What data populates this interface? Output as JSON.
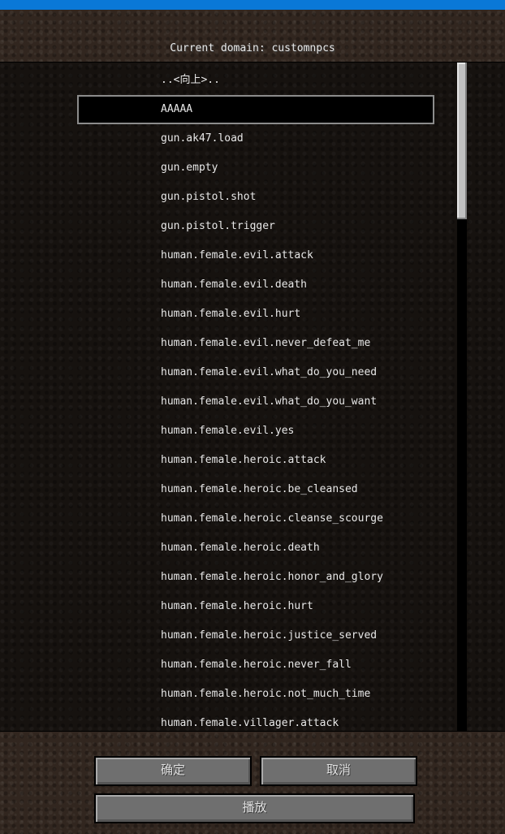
{
  "header": {
    "title": "Current domain: customnpcs"
  },
  "file_list": {
    "items": [
      "..<向上>..",
      "AAAAA",
      "gun.ak47.load",
      "gun.empty",
      "gun.pistol.shot",
      "gun.pistol.trigger",
      "human.female.evil.attack",
      "human.female.evil.death",
      "human.female.evil.hurt",
      "human.female.evil.never_defeat_me",
      "human.female.evil.what_do_you_need",
      "human.female.evil.what_do_you_want",
      "human.female.evil.yes",
      "human.female.heroic.attack",
      "human.female.heroic.be_cleansed",
      "human.female.heroic.cleanse_scourge",
      "human.female.heroic.death",
      "human.female.heroic.honor_and_glory",
      "human.female.heroic.hurt",
      "human.female.heroic.justice_served",
      "human.female.heroic.never_fall",
      "human.female.heroic.not_much_time",
      "human.female.villager.attack"
    ],
    "selected_index": 1
  },
  "buttons": {
    "confirm": "确定",
    "cancel": "取消",
    "play": "播放"
  },
  "colors": {
    "top_accent": "#0a78d7",
    "selection_border": "#8c8c8c",
    "button_face": "#6f6f6f"
  }
}
